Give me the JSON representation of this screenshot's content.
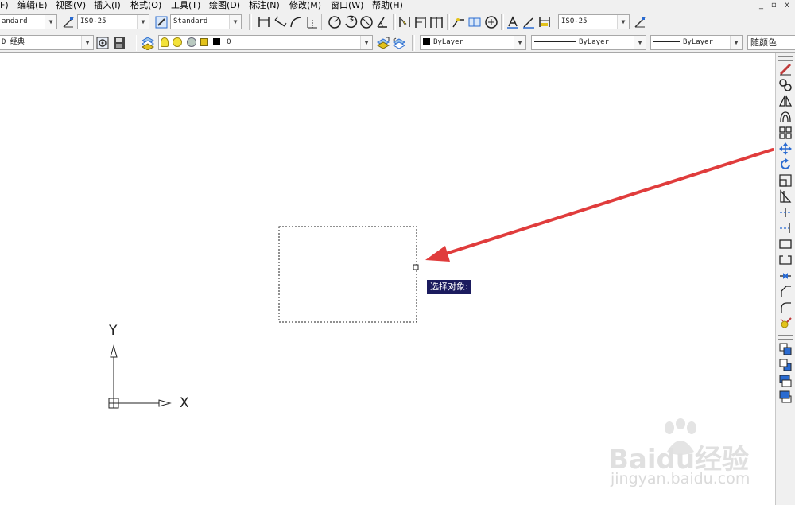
{
  "menu": {
    "items": [
      "F)",
      "编辑(E)",
      "视图(V)",
      "插入(I)",
      "格式(O)",
      "工具(T)",
      "绘图(D)",
      "标注(N)",
      "修改(M)",
      "窗口(W)",
      "帮助(H)"
    ],
    "window_controls": [
      "_",
      "▫",
      "x"
    ]
  },
  "styles_toolbar": {
    "text_style": "andard",
    "dim_style": "ISO-25",
    "table_style": "Standard",
    "dim_style_2": "ISO-25"
  },
  "layers_toolbar": {
    "workspace": "D 经典",
    "layer_name": "0"
  },
  "properties_toolbar": {
    "color": "ByLayer",
    "linetype": "ByLayer",
    "lineweight": "ByLayer",
    "plot_style": "随颜色"
  },
  "drawing": {
    "ucs_y_label": "Y",
    "ucs_x_label": "X",
    "tooltip": "选择对象:"
  },
  "watermark": {
    "brand": "Baidu经验",
    "url": "jingyan.baidu.com"
  },
  "colors": {
    "arrow": "#e03c3c",
    "tooltip_bg": "#1b1b5e",
    "toolbar_bg": "#f0f0f0"
  },
  "icons": {
    "top_toolbar": [
      "dimstyle-icon",
      "textstyle-icon",
      "linear-dimension-icon",
      "aligned-dimension-icon",
      "arc-length-icon",
      "ordinate-icon",
      "radius-icon",
      "jogged-icon",
      "diameter-icon",
      "angular-icon",
      "quick-dimension-icon",
      "baseline-icon",
      "continue-icon",
      "leader-icon",
      "tolerance-icon",
      "center-mark-icon",
      "dimedit-icon",
      "dimtedit-icon",
      "dimupdate-icon"
    ],
    "modify_panel": [
      "erase-icon",
      "copy-icon",
      "mirror-icon",
      "offset-icon",
      "array-icon",
      "move-icon",
      "rotate-icon",
      "scale-icon",
      "stretch-icon",
      "trim-icon",
      "extend-icon",
      "break-at-point-icon",
      "break-icon",
      "join-icon",
      "chamfer-icon",
      "fillet-icon",
      "explode-icon",
      "bring-front-icon",
      "send-back-icon",
      "bring-above-icon",
      "send-under-icon"
    ]
  }
}
